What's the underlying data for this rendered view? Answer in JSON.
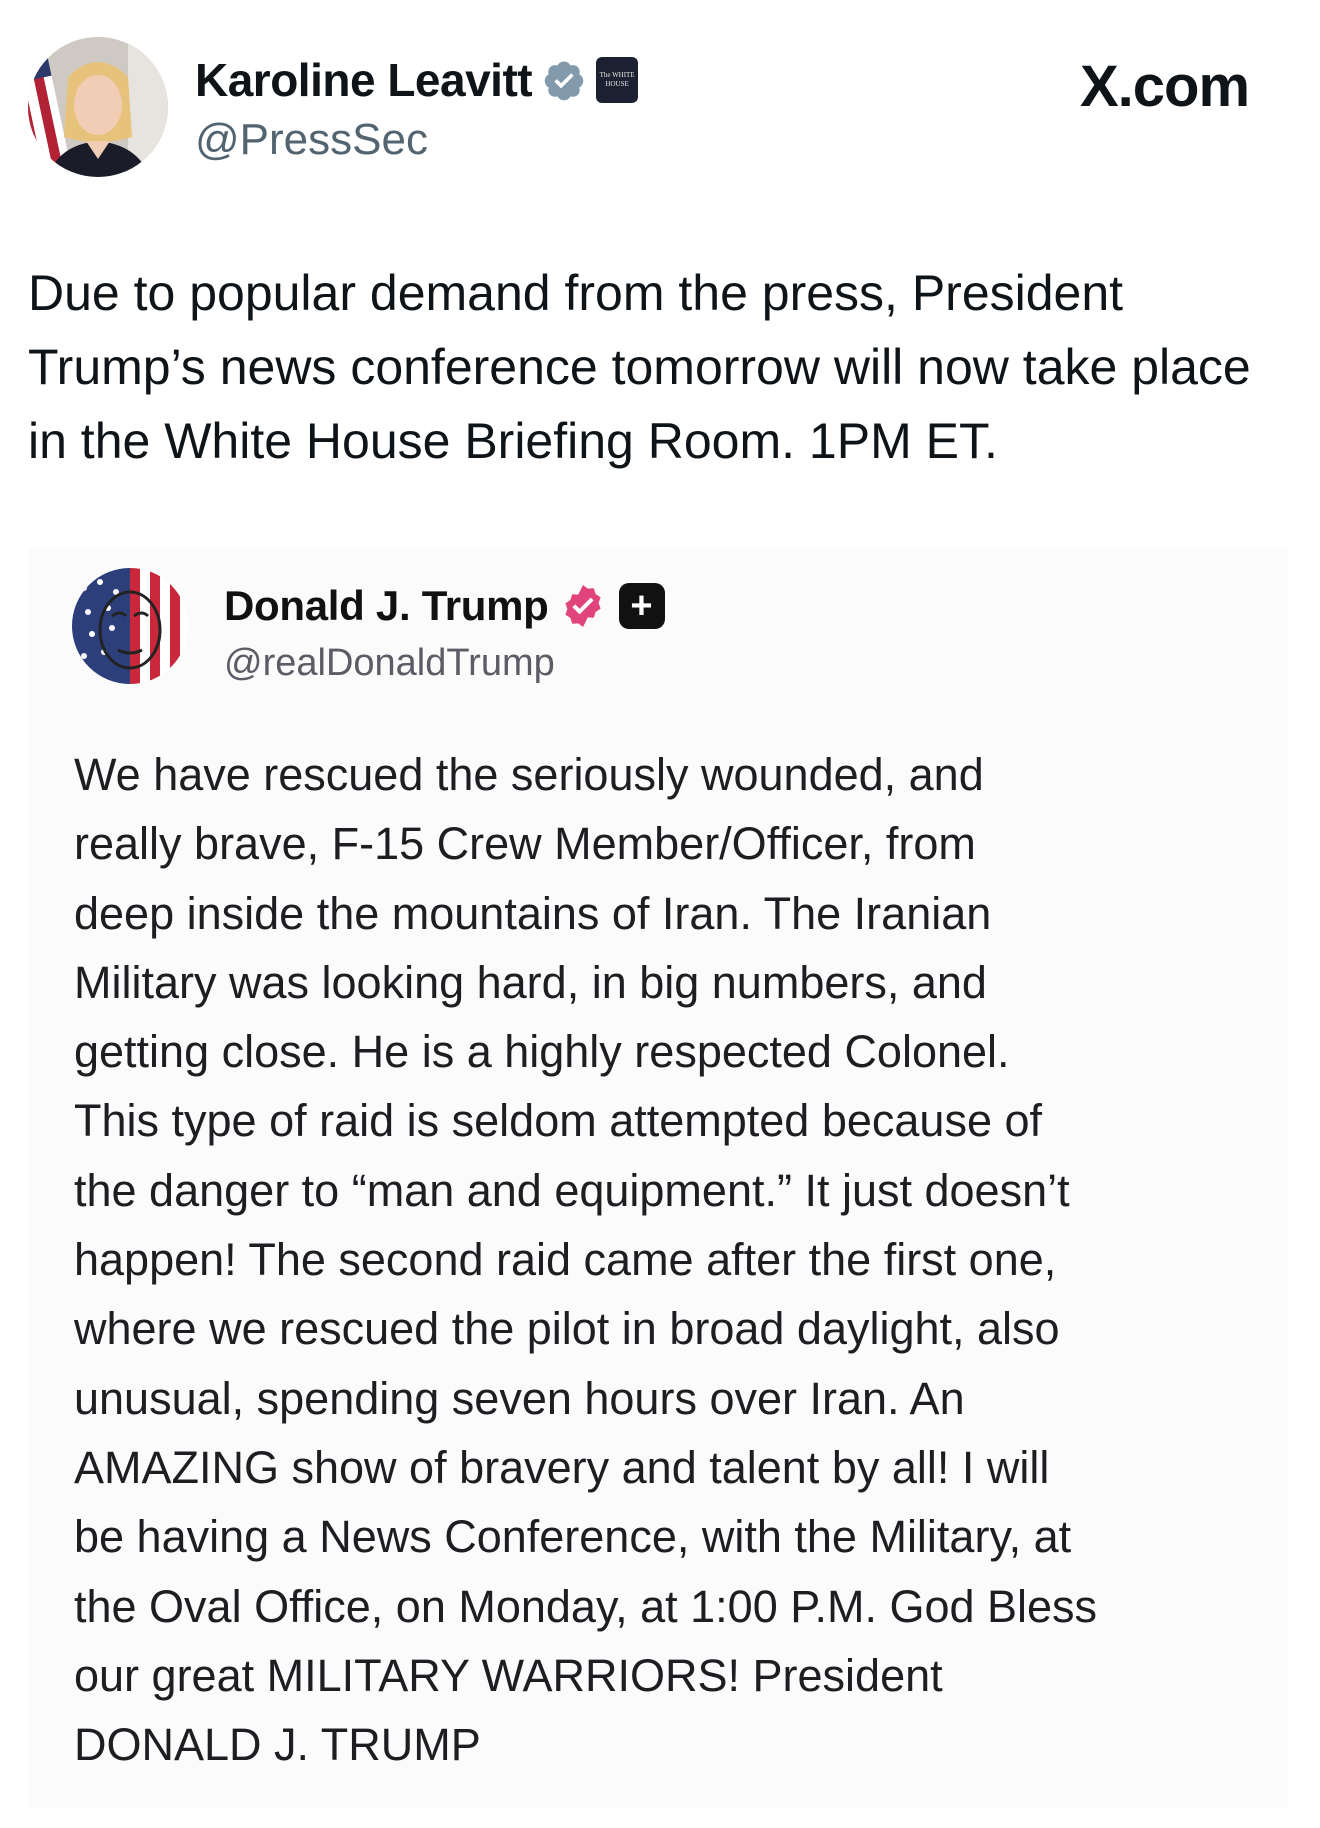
{
  "author": {
    "name": "Karoline Leavitt",
    "handle": "@PressSec",
    "badge_text": "The WHITE HOUSE",
    "verified_icon": "verified-check-icon"
  },
  "site_label": "X.com",
  "tweet": {
    "text": "Due to popular demand from the press, President Trump’s news conference tomorrow will now take place in the White House Briefing Room. 1PM ET."
  },
  "quoted_post": {
    "name": "Donald J. Trump",
    "handle": "@realDonaldTrump",
    "plus_label": "+",
    "verified_icon": "verified-badge-icon",
    "text": "We have rescued the seriously wounded, and\nreally brave, F-15 Crew Member/Officer, from\ndeep inside the mountains of Iran. The Iranian\nMilitary was looking hard, in big numbers, and\ngetting close. He is a highly respected Colonel.\nThis type of raid is seldom attempted because of\nthe danger to “man and equipment.” It just doesn’t\nhappen! The second raid came after the first one,\nwhere we rescued the pilot in broad daylight, also\nunusual, spending seven hours over Iran. An\nAMAZING show of bravery and talent by all! I will\nbe having a News Conference, with the Military, at\nthe Oval Office, on Monday, at 1:00 P.M. God Bless\nour great MILITARY WARRIORS! President\nDONALD J. TRUMP"
  },
  "colors": {
    "text": "#0f1419",
    "secondary": "#536471",
    "verified_blue": "#1d9bf0",
    "truth_badge": "#e0447a",
    "quote_bg": "#fbfbfc"
  }
}
